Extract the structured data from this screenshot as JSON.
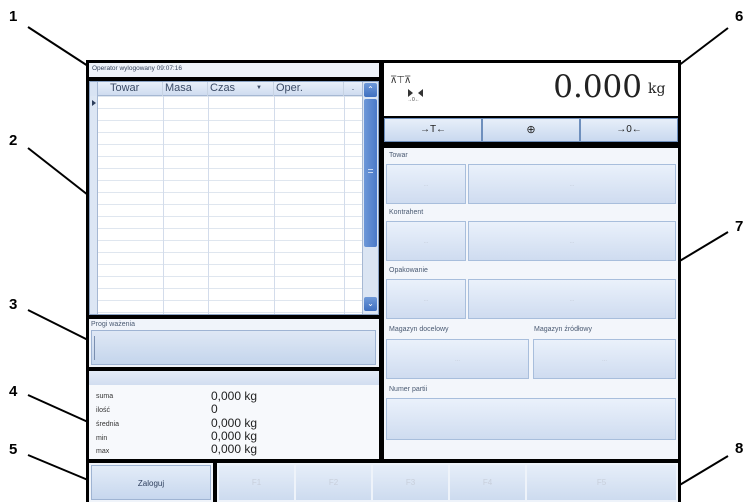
{
  "callouts": [
    "1",
    "2",
    "3",
    "4",
    "5",
    "6",
    "7",
    "8"
  ],
  "status_bar": {
    "text": "Operator wylogowany 09:07:16"
  },
  "table": {
    "columns": [
      "Towar",
      "Masa",
      "Czas",
      "Oper."
    ],
    "sort_indicator": "▼",
    "extra_col": "."
  },
  "thresholds": {
    "label": "Progi ważenia"
  },
  "stats": {
    "rows": [
      {
        "label": "suma",
        "value": "0,000 kg"
      },
      {
        "label": "ilość",
        "value": "0"
      },
      {
        "label": "średnia",
        "value": "0,000 kg"
      },
      {
        "label": "min",
        "value": "0,000 kg"
      },
      {
        "label": "max",
        "value": "0,000 kg"
      }
    ]
  },
  "login_button": {
    "label": "Zaloguj"
  },
  "function_keys": [
    "F1",
    "F2",
    "F3",
    "F4",
    "F5"
  ],
  "scale": {
    "weight": "0.000",
    "unit": "kg",
    "icon_left": "⊼⊤⊼",
    "zero_icon_label": "→0←",
    "buttons": [
      "→T←",
      "⊕",
      "→0←"
    ]
  },
  "fields": {
    "towar": "Towar",
    "kontrahent": "Kontrahent",
    "opakowanie": "Opakowanie",
    "magazyn_docelowy": "Magazyn docelowy",
    "magazyn_zrodlowy": "Magazyn źródłowy",
    "numer_partii": "Numer partii",
    "placeholder": "..."
  },
  "colors": {
    "frame": "#000000",
    "accent": "#3f74c9",
    "panel": "#f4f7fb"
  }
}
